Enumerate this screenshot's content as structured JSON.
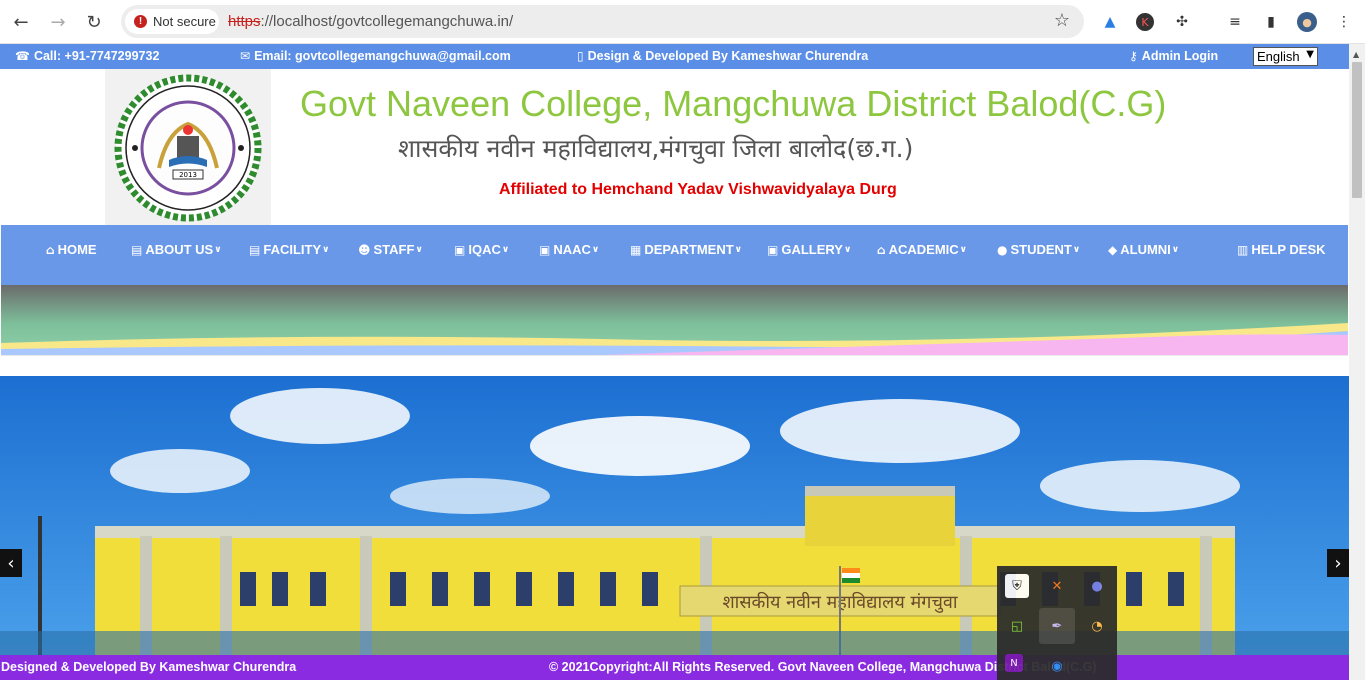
{
  "browser": {
    "security_label": "Not secure",
    "url_scheme": "https",
    "url_rest": "://localhost/govtcollegemangchuwa.in/"
  },
  "topbar": {
    "call": "Call: +91-7747299732",
    "email": "Email: govtcollegemangchuwa@gmail.com",
    "design": "Design & Developed By Kameshwar Churendra",
    "admin": "Admin Login",
    "language": "English"
  },
  "header": {
    "logo_year": "2013",
    "title_en": "Govt Naveen College, Mangchuwa District Balod(C.G)",
    "title_hi": "शासकीय नवीन महाविद्यालय,मंगचुवा जिला बालोद(छ.ग.)",
    "affiliation": "Affiliated to Hemchand Yadav Vishwavidyalaya Durg"
  },
  "nav": {
    "items": [
      {
        "label": "HOME",
        "icon": "home-icon",
        "dropdown": false
      },
      {
        "label": "ABOUT US",
        "icon": "id-card-icon",
        "dropdown": true
      },
      {
        "label": "FACILITY",
        "icon": "id-card-icon",
        "dropdown": true
      },
      {
        "label": "STAFF",
        "icon": "users-icon",
        "dropdown": true
      },
      {
        "label": "IQAC",
        "icon": "image-icon",
        "dropdown": true
      },
      {
        "label": "NAAC",
        "icon": "image-icon",
        "dropdown": true
      },
      {
        "label": "DEPARTMENT",
        "icon": "building-icon",
        "dropdown": true
      },
      {
        "label": "GALLERY",
        "icon": "image-icon",
        "dropdown": true
      },
      {
        "label": "ACADEMIC",
        "icon": "university-icon",
        "dropdown": true
      },
      {
        "label": "STUDENT",
        "icon": "user-icon",
        "dropdown": true
      },
      {
        "label": "ALUMNI",
        "icon": "graduation-cap-icon",
        "dropdown": true
      },
      {
        "label": "HELP DESK",
        "icon": "address-book-icon",
        "dropdown": false
      }
    ]
  },
  "hero": {
    "building_sign": "शासकीय नवीन महाविद्यालय मंगचुवा"
  },
  "footer": {
    "left": "Designed & Developed By Kameshwar Churendra",
    "right": "© 2021Copyright:All Rights Reserved. Govt Naveen College, Mangchuwa District Balod(C.G)"
  },
  "colors": {
    "topbar": "#5b8ee6",
    "nav": "#6a98e8",
    "title": "#8dc63f",
    "affiliation": "#e30000",
    "footer": "#8a2be2"
  }
}
